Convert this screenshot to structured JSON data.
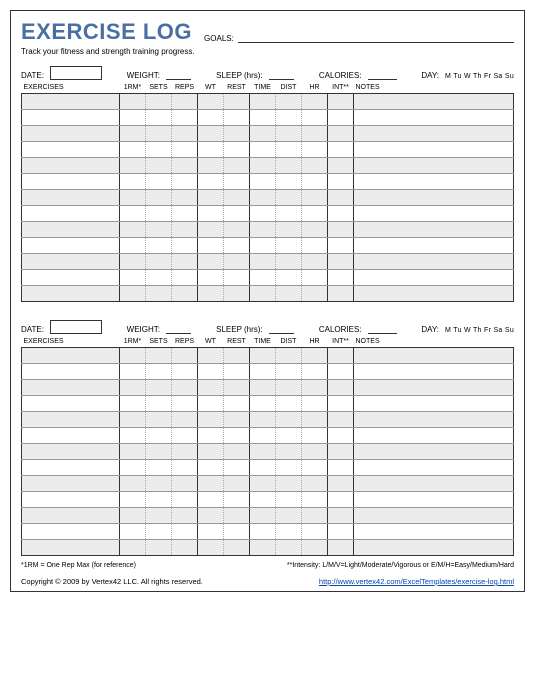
{
  "header": {
    "title": "EXERCISE LOG",
    "subtitle": "Track your fitness and strength training progress.",
    "goals_label": "GOALS:"
  },
  "session": {
    "date_label": "DATE:",
    "weight_label": "WEIGHT:",
    "sleep_label": "SLEEP (hrs):",
    "calories_label": "CALORIES:",
    "day_label": "DAY:",
    "days": "M Tu W Th Fr Sa Su"
  },
  "columns": {
    "exercises": "EXERCISES",
    "one_rm": "1RM*",
    "sets": "SETS",
    "reps": "REPS",
    "wt": "WT",
    "rest": "REST",
    "time": "TIME",
    "dist": "DIST",
    "hr": "HR",
    "int": "INT**",
    "notes": "NOTES"
  },
  "rows_per_block": 13,
  "footnotes": {
    "left": "*1RM = One Rep Max (for reference)",
    "right": "**Intensity: L/M/V=Light/Moderate/Vigorous or E/M/H=Easy/Medium/Hard"
  },
  "footer": {
    "copyright": "Copyright © 2009 by Vertex42 LLC. All rights reserved.",
    "url": "http://www.vertex42.com/ExcelTemplates/exercise-log.html"
  }
}
